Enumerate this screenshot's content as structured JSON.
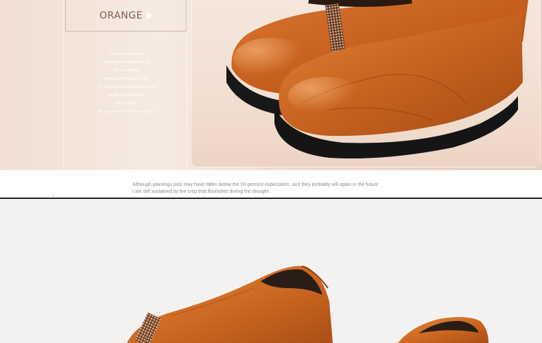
{
  "banner": {
    "color_label": "ORANGE",
    "features": [
      "The fashionable breath",
      "Upgrade germinating in the air",
      "The new ultra light",
      "Martin beads like English skills",
      "The idea of the simple yet simple shoe",
      "Design, high quality light",
      "Shoe material",
      "Wearing a very comfortable and light."
    ]
  },
  "caption": {
    "line1": "Although plantings past may have fallen below the 50-percent expectation, and they probably will again in the future",
    "line2": "I am still sustained by the crop that flourishes during the drought."
  },
  "colors": {
    "leather": "#c8601f",
    "leather_dark": "#8e3f12",
    "sole": "#1b1b1b"
  }
}
